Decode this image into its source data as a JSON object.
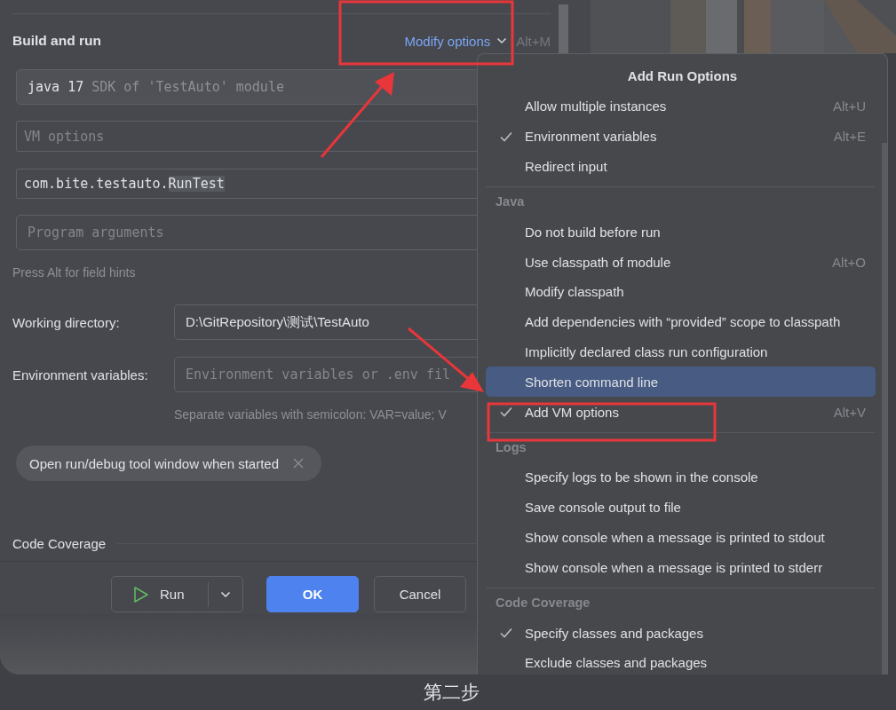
{
  "dialog": {
    "section_title": "Build and run",
    "modify_options": {
      "label": "Modify options",
      "shortcut": "Alt+M"
    },
    "sdk_field": {
      "value": "java 17",
      "hint": "SDK of 'TestAuto' module"
    },
    "vm_options_field": {
      "placeholder": "VM options"
    },
    "main_class_field": {
      "parts": [
        {
          "text": "com.bite.testauto.",
          "highlighted": false
        },
        {
          "text": "RunTest",
          "highlighted": true
        }
      ]
    },
    "program_arguments_field": {
      "placeholder": "Program arguments"
    },
    "field_hint": "Press Alt for field hints",
    "working_directory": {
      "label": "Working directory:",
      "value": "D:\\GitRepository\\测试\\TestAuto"
    },
    "environment_variables": {
      "label": "Environment variables:",
      "placeholder": "Environment variables or .env fil",
      "hint": "Separate variables with semicolon: VAR=value; V"
    },
    "chips": [
      {
        "label": "Open run/debug tool window when started"
      }
    ],
    "code_coverage_title": "Code Coverage",
    "buttons": [
      {
        "label": "Run",
        "kind": "split"
      },
      {
        "label": "OK",
        "kind": "primary"
      },
      {
        "label": "Cancel",
        "kind": "secondary"
      }
    ]
  },
  "popup": {
    "title": "Add Run Options",
    "groups": [
      {
        "items": [
          {
            "label": "Allow multiple instances",
            "shortcut": "Alt+U",
            "checked": false,
            "selected": false
          },
          {
            "label": "Environment variables",
            "shortcut": "Alt+E",
            "checked": true,
            "selected": false
          },
          {
            "label": "Redirect input",
            "checked": false,
            "selected": false
          }
        ]
      },
      {
        "header": "Java",
        "items": [
          {
            "label": "Do not build before run",
            "checked": false,
            "selected": false
          },
          {
            "label": "Use classpath of module",
            "shortcut": "Alt+O",
            "checked": false,
            "selected": false
          },
          {
            "label": "Modify classpath",
            "checked": false,
            "selected": false
          },
          {
            "label": "Add dependencies with “provided” scope to classpath",
            "checked": false,
            "selected": false
          },
          {
            "label": "Implicitly declared class run configuration",
            "checked": false,
            "selected": false
          },
          {
            "label": "Shorten command line",
            "checked": false,
            "selected": true
          },
          {
            "label": "Add VM options",
            "shortcut": "Alt+V",
            "checked": true,
            "selected": false
          }
        ]
      },
      {
        "header": "Logs",
        "items": [
          {
            "label": "Specify logs to be shown in the console",
            "checked": false,
            "selected": false
          },
          {
            "label": "Save console output to file",
            "checked": false,
            "selected": false
          },
          {
            "label": "Show console when a message is printed to stdout",
            "checked": false,
            "selected": false
          },
          {
            "label": "Show console when a message is printed to stderr",
            "checked": false,
            "selected": false
          }
        ]
      },
      {
        "header": "Code Coverage",
        "items": [
          {
            "label": "Specify classes and packages",
            "checked": true,
            "selected": false
          },
          {
            "label": "Exclude classes and packages",
            "checked": false,
            "selected": false
          }
        ]
      }
    ]
  },
  "caption": "第二步"
}
